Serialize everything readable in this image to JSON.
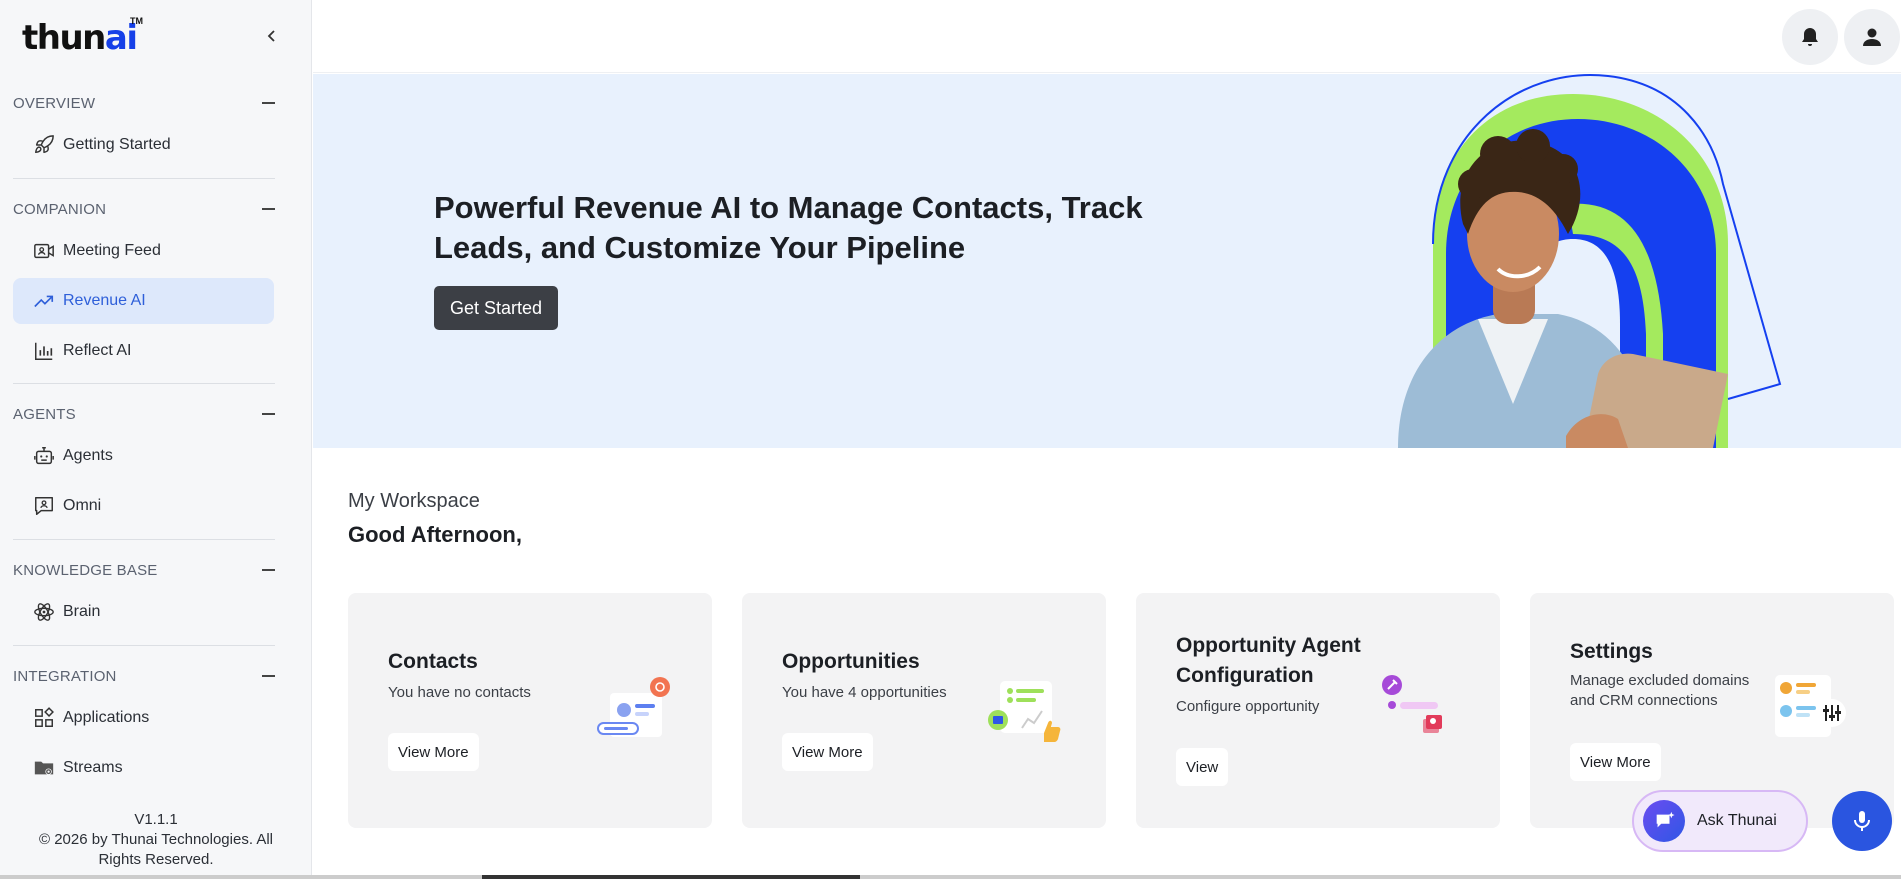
{
  "brand": {
    "logo_main": "thun",
    "logo_ai": "ai",
    "logo_tm": "TM"
  },
  "sidebar": {
    "sections": [
      {
        "label": "OVERVIEW",
        "items": [
          {
            "label": "Getting Started",
            "icon": "rocket-icon"
          }
        ]
      },
      {
        "label": "COMPANION",
        "items": [
          {
            "label": "Meeting Feed",
            "icon": "video-card-icon"
          },
          {
            "label": "Revenue AI",
            "icon": "trending-up-icon",
            "active": true
          },
          {
            "label": "Reflect AI",
            "icon": "bar-chart-icon"
          }
        ]
      },
      {
        "label": "AGENTS",
        "items": [
          {
            "label": "Agents",
            "icon": "robot-icon"
          },
          {
            "label": "Omni",
            "icon": "chat-person-icon"
          }
        ]
      },
      {
        "label": "KNOWLEDGE BASE",
        "items": [
          {
            "label": "Brain",
            "icon": "atom-icon"
          }
        ]
      },
      {
        "label": "INTEGRATION",
        "items": [
          {
            "label": "Applications",
            "icon": "apps-grid-icon"
          },
          {
            "label": "Streams",
            "icon": "folder-gear-icon"
          }
        ]
      }
    ],
    "version": "V1.1.1",
    "copyright_line1": "© 2026 by Thunai Technologies. All",
    "copyright_line2": "Rights Reserved."
  },
  "hero": {
    "title": "Powerful Revenue AI to Manage Contacts, Track Leads, and Customize Your Pipeline",
    "button": "Get Started"
  },
  "workspace": {
    "subtitle": "My Workspace",
    "greeting": "Good Afternoon,"
  },
  "cards": [
    {
      "title": "Contacts",
      "description": "You have no contacts",
      "button": "View More"
    },
    {
      "title": "Opportunities",
      "description": "You have 4 opportunities",
      "button": "View More"
    },
    {
      "title": "Opportunity Agent Configuration",
      "description": "Configure opportunity",
      "button": "View"
    },
    {
      "title": "Settings",
      "description": "Manage excluded domains and CRM connections",
      "button": "View More"
    }
  ],
  "assistant": {
    "ask_label": "Ask Thunai"
  },
  "colors": {
    "accent": "#2e5fd9",
    "active_bg": "#dde8fb",
    "hero_bg": "#e8f1fd",
    "brand_blue": "#1640e8"
  }
}
